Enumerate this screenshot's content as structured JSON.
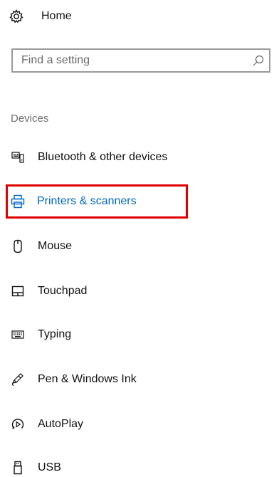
{
  "home": {
    "label": "Home",
    "icon": "gear-icon"
  },
  "search": {
    "placeholder": "Find a setting",
    "value": "",
    "icon": "search-icon"
  },
  "section": {
    "heading": "Devices"
  },
  "nav": {
    "items": [
      {
        "label": "Bluetooth & other devices",
        "icon": "bluetooth-devices-icon",
        "selected": false
      },
      {
        "label": "Printers & scanners",
        "icon": "printer-icon",
        "selected": true
      },
      {
        "label": "Mouse",
        "icon": "mouse-icon",
        "selected": false
      },
      {
        "label": "Touchpad",
        "icon": "touchpad-icon",
        "selected": false
      },
      {
        "label": "Typing",
        "icon": "keyboard-icon",
        "selected": false
      },
      {
        "label": "Pen & Windows Ink",
        "icon": "pen-icon",
        "selected": false
      },
      {
        "label": "AutoPlay",
        "icon": "autoplay-icon",
        "selected": false
      },
      {
        "label": "USB",
        "icon": "usb-icon",
        "selected": false
      }
    ]
  },
  "colors": {
    "accent": "#0067c0",
    "selection_outline": "#e00000",
    "section_heading": "#6f6f6f",
    "search_border": "#9a9a9a"
  }
}
